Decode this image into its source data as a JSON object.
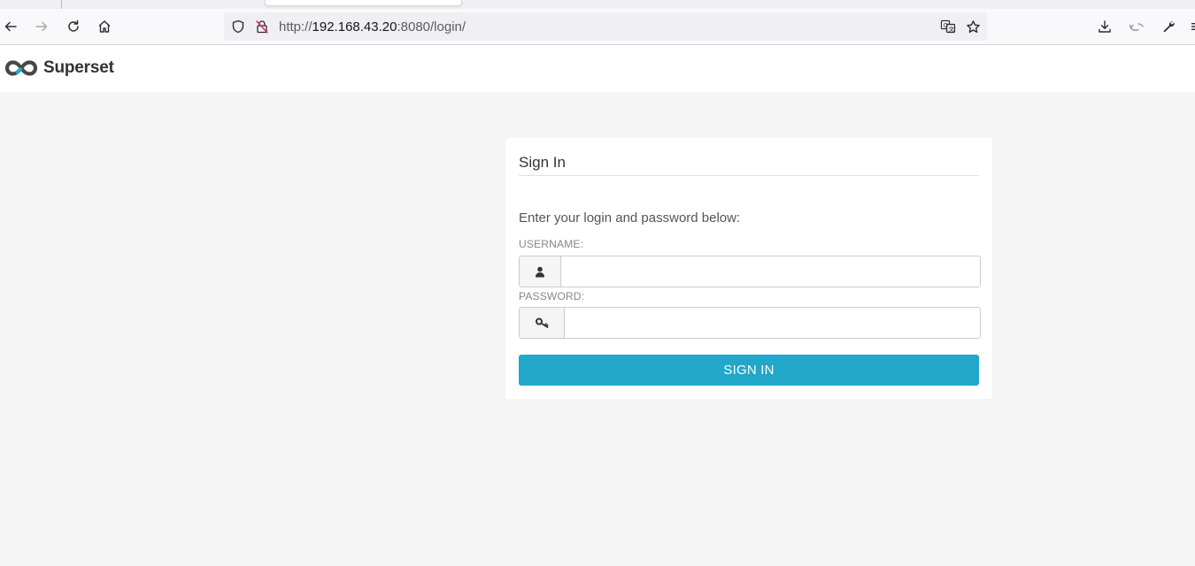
{
  "browser": {
    "url_scheme": "http://",
    "url_host": "192.168.43.20",
    "url_rest": ":8080/login/",
    "icons": [
      "back-icon",
      "forward-icon",
      "reload-icon",
      "home-icon",
      "shield-icon",
      "insecure-lock-icon",
      "translate-icon",
      "bookmark-star-icon",
      "download-icon",
      "sync-icon",
      "wrench-icon"
    ]
  },
  "app": {
    "brand_name": "Superset",
    "logo_colors": {
      "primary": "#484848",
      "accent": "#20a7c9"
    }
  },
  "login": {
    "title": "Sign In",
    "instructions": "Enter your login and password below:",
    "username_label": "USERNAME:",
    "username_value": "",
    "password_label": "PASSWORD:",
    "password_value": "",
    "submit_label": "SIGN IN",
    "accent_color": "#20a7c9"
  }
}
